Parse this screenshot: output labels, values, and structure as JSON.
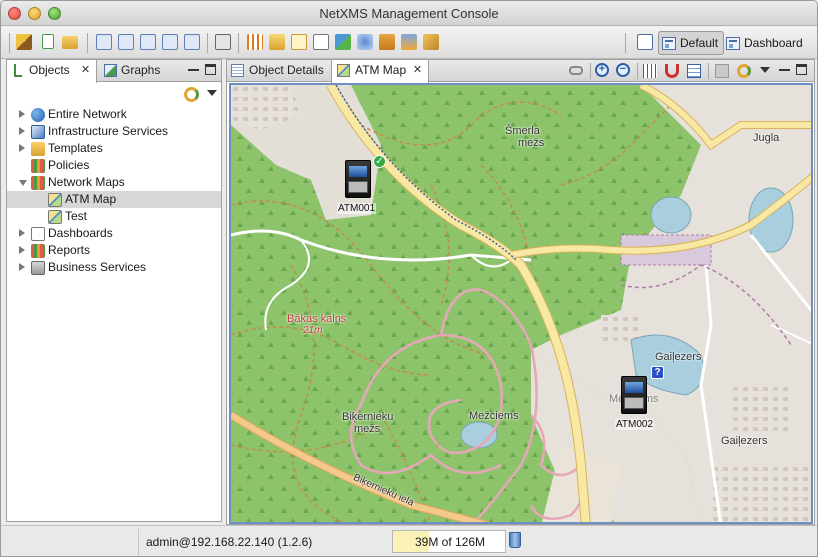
{
  "window": {
    "title": "NetXMS Management Console"
  },
  "toolbar": {
    "perspectives": [
      {
        "label": "Default",
        "active": true
      },
      {
        "label": "Dashboard",
        "active": false
      }
    ]
  },
  "left_panel": {
    "tabs": [
      {
        "label": "Objects",
        "active": true
      },
      {
        "label": "Graphs",
        "active": false
      }
    ],
    "tree": [
      {
        "label": "Entire Network",
        "expanded": false,
        "level": 0
      },
      {
        "label": "Infrastructure Services",
        "expanded": false,
        "level": 0
      },
      {
        "label": "Templates",
        "expanded": false,
        "level": 0
      },
      {
        "label": "Policies",
        "expanded": null,
        "level": 0
      },
      {
        "label": "Network Maps",
        "expanded": true,
        "level": 0
      },
      {
        "label": "ATM Map",
        "expanded": null,
        "level": 1,
        "selected": true
      },
      {
        "label": "Test",
        "expanded": null,
        "level": 1
      },
      {
        "label": "Dashboards",
        "expanded": false,
        "level": 0
      },
      {
        "label": "Reports",
        "expanded": false,
        "level": 0
      },
      {
        "label": "Business Services",
        "expanded": false,
        "level": 0
      }
    ]
  },
  "editor": {
    "tabs": [
      {
        "label": "Object Details",
        "active": false
      },
      {
        "label": "ATM Map",
        "active": true
      }
    ]
  },
  "map": {
    "labels": [
      {
        "text": "Šmerla"
      },
      {
        "text": "mežs"
      },
      {
        "text": "Jugla"
      },
      {
        "text": "Bākas kalns"
      },
      {
        "text": "21m"
      },
      {
        "text": "Gaiļezers"
      },
      {
        "text": "Biķernieku"
      },
      {
        "text": "mežs"
      },
      {
        "text": "Mežciems"
      },
      {
        "text": "Mežciems"
      },
      {
        "text": "Gaiļezers"
      },
      {
        "text": "Biķernieku iela"
      }
    ],
    "nodes": [
      {
        "name": "ATM001",
        "status": "normal",
        "status_color": "#3aa84a"
      },
      {
        "name": "ATM002",
        "status": "unknown",
        "status_color": "#2a4fc4"
      }
    ]
  },
  "status": {
    "connection": "admin@192.168.22.140 (1.2.6)",
    "memory": "39M of 126M"
  },
  "colors": {
    "forest": "#8dc46b",
    "urban": "#e6e1da",
    "road_major": "#f7e9a4",
    "road_outline": "#e0b860",
    "selection": "#d7d7d7"
  }
}
